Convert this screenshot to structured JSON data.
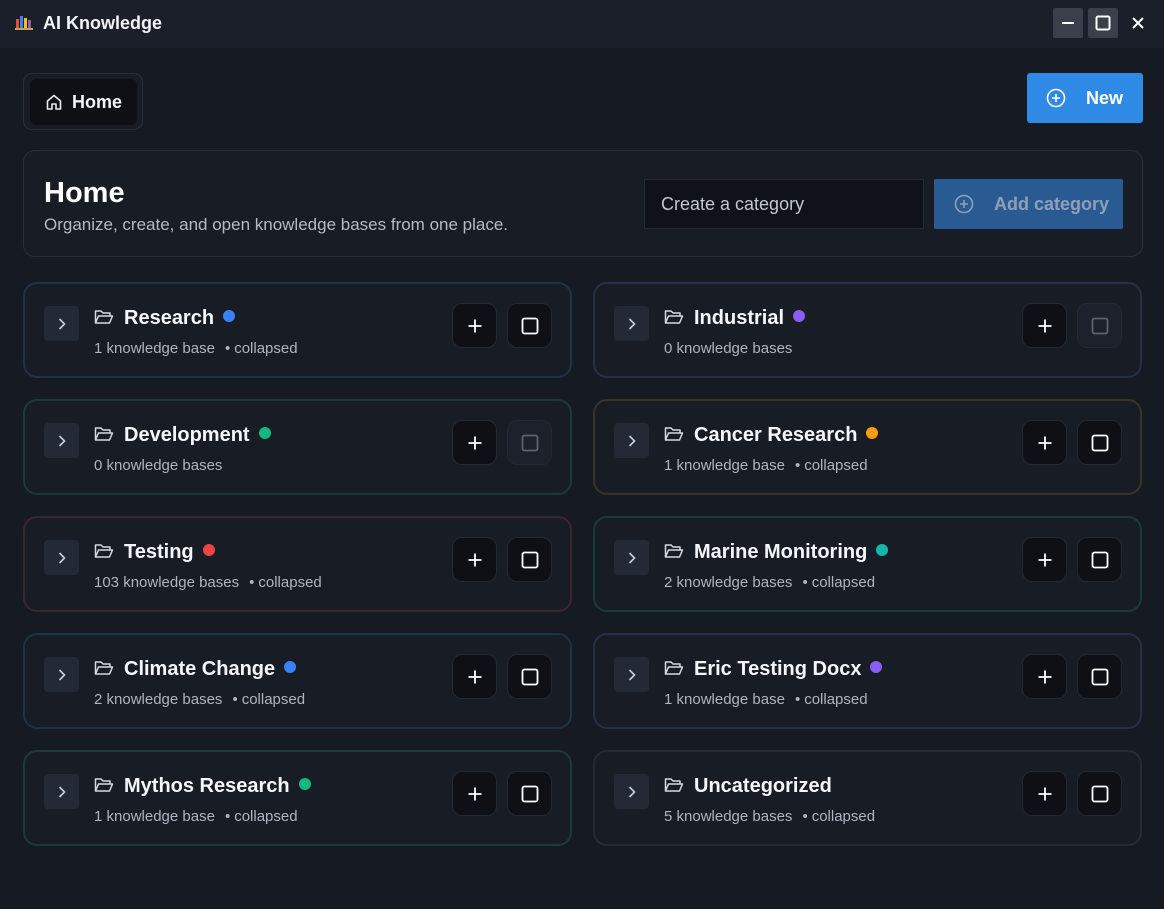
{
  "window": {
    "title": "AI Knowledge"
  },
  "nav": {
    "home_label": "Home",
    "new_label": "New"
  },
  "header": {
    "title": "Home",
    "subtitle": "Organize, create, and open knowledge bases from one place.",
    "category_placeholder": "Create a category",
    "add_category_label": "Add category"
  },
  "categories": [
    {
      "name": "Research",
      "dot_color": "#3b82f6",
      "count": "1 knowledge base",
      "state": "collapsed",
      "border": "#1f3344",
      "select_enabled": true
    },
    {
      "name": "Industrial",
      "dot_color": "#8b5cf6",
      "count": "0 knowledge bases",
      "state": "",
      "border": "#26304a",
      "select_enabled": false
    },
    {
      "name": "Development",
      "dot_color": "#10b981",
      "count": "0 knowledge bases",
      "state": "",
      "border": "#1c3a38",
      "select_enabled": false
    },
    {
      "name": "Cancer Research",
      "dot_color": "#f59e0b",
      "count": "1 knowledge base",
      "state": "collapsed",
      "border": "#3a3426",
      "select_enabled": true
    },
    {
      "name": "Testing",
      "dot_color": "#ef4444",
      "count": "103 knowledge bases",
      "state": "collapsed",
      "border": "#3b2630",
      "select_enabled": true
    },
    {
      "name": "Marine Monitoring",
      "dot_color": "#14b8a6",
      "count": "2 knowledge bases",
      "state": "collapsed",
      "border": "#1a3b3c",
      "select_enabled": true
    },
    {
      "name": "Climate Change",
      "dot_color": "#3b82f6",
      "count": "2 knowledge bases",
      "state": "collapsed",
      "border": "#1f3344",
      "select_enabled": true
    },
    {
      "name": "Eric Testing Docx",
      "dot_color": "#8b5cf6",
      "count": "1 knowledge base",
      "state": "collapsed",
      "border": "#26304a",
      "select_enabled": true
    },
    {
      "name": "Mythos Research",
      "dot_color": "#10b981",
      "count": "1 knowledge base",
      "state": "collapsed",
      "border": "#1c3a38",
      "select_enabled": true
    },
    {
      "name": "Uncategorized",
      "dot_color": "",
      "count": "5 knowledge bases",
      "state": "collapsed",
      "border": "#272b35",
      "select_enabled": true
    }
  ]
}
